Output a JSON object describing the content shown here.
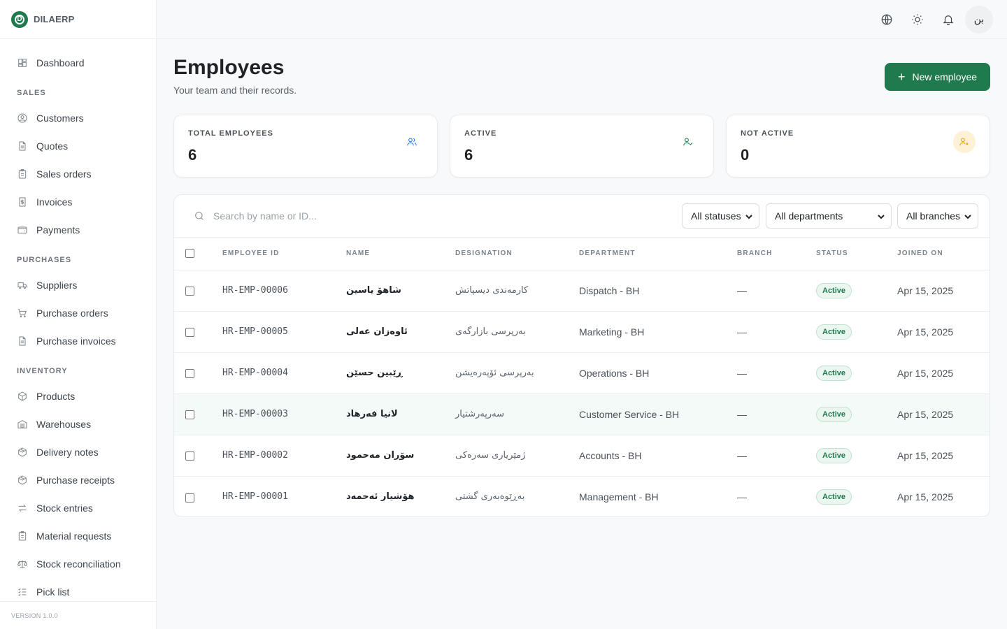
{
  "brand": {
    "logo_letter": "D",
    "name": "DILAERP"
  },
  "sidebar": {
    "top_items": [
      {
        "label": "Dashboard",
        "icon": "dashboard-icon"
      }
    ],
    "sections": [
      {
        "title": "SALES",
        "items": [
          {
            "label": "Customers",
            "icon": "user-circle-icon"
          },
          {
            "label": "Quotes",
            "icon": "document-icon"
          },
          {
            "label": "Sales orders",
            "icon": "clipboard-icon"
          },
          {
            "label": "Invoices",
            "icon": "invoice-icon"
          },
          {
            "label": "Payments",
            "icon": "wallet-icon"
          }
        ]
      },
      {
        "title": "PURCHASES",
        "items": [
          {
            "label": "Suppliers",
            "icon": "truck-icon"
          },
          {
            "label": "Purchase orders",
            "icon": "cart-icon"
          },
          {
            "label": "Purchase invoices",
            "icon": "document-icon"
          }
        ]
      },
      {
        "title": "INVENTORY",
        "items": [
          {
            "label": "Products",
            "icon": "box-icon"
          },
          {
            "label": "Warehouses",
            "icon": "warehouse-icon"
          },
          {
            "label": "Delivery notes",
            "icon": "package-icon"
          },
          {
            "label": "Purchase receipts",
            "icon": "package-icon"
          },
          {
            "label": "Stock entries",
            "icon": "arrows-icon"
          },
          {
            "label": "Material requests",
            "icon": "clipboard-icon"
          },
          {
            "label": "Stock reconciliation",
            "icon": "scale-icon"
          },
          {
            "label": "Pick list",
            "icon": "checklist-icon"
          }
        ]
      }
    ],
    "version": "VERSION 1.0.0"
  },
  "topbar": {
    "avatar_text": "بن"
  },
  "page": {
    "title": "Employees",
    "subtitle": "Your team and their records.",
    "new_button": "New employee"
  },
  "stats": [
    {
      "label": "TOTAL EMPLOYEES",
      "value": "6",
      "icon": "users-icon",
      "color": "#2b7bd6",
      "bg": "#ffffff"
    },
    {
      "label": "ACTIVE",
      "value": "6",
      "icon": "user-check-icon",
      "color": "#1f7a4d",
      "bg": "#ffffff"
    },
    {
      "label": "NOT ACTIVE",
      "value": "0",
      "icon": "user-x-icon",
      "color": "#e0a21b",
      "bg": "#fdf1d6"
    }
  ],
  "filters": {
    "search_placeholder": "Search by name or ID...",
    "status": "All statuses",
    "department": "All departments",
    "branch": "All branches"
  },
  "table": {
    "headers": [
      "EMPLOYEE ID",
      "NAME",
      "DESIGNATION",
      "DEPARTMENT",
      "BRANCH",
      "STATUS",
      "JOINED ON"
    ],
    "rows": [
      {
        "id": "HR-EMP-00006",
        "name": "شاهۆ یاسین",
        "designation": "کارمەندی دیسپاتش",
        "department": "Dispatch - BH",
        "branch": "—",
        "status": "Active",
        "joined": "Apr 15, 2025"
      },
      {
        "id": "HR-EMP-00005",
        "name": "ئاوەزان عەلی",
        "designation": "بەرپرسی بازارگەی",
        "department": "Marketing - BH",
        "branch": "—",
        "status": "Active",
        "joined": "Apr 15, 2025"
      },
      {
        "id": "HR-EMP-00004",
        "name": "ڕێبین حسێن",
        "designation": "بەرپرسی ئۆپەرەیشن",
        "department": "Operations - BH",
        "branch": "—",
        "status": "Active",
        "joined": "Apr 15, 2025"
      },
      {
        "id": "HR-EMP-00003",
        "name": "لانیا فەرهاد",
        "designation": "سەرپەرشتیار",
        "department": "Customer Service - BH",
        "branch": "—",
        "status": "Active",
        "joined": "Apr 15, 2025"
      },
      {
        "id": "HR-EMP-00002",
        "name": "سۆران مەحمود",
        "designation": "ژمێرياری سەرەکی",
        "department": "Accounts - BH",
        "branch": "—",
        "status": "Active",
        "joined": "Apr 15, 2025"
      },
      {
        "id": "HR-EMP-00001",
        "name": "هۆشیار ئەحمەد",
        "designation": "بەڕێوەبەری گشتی",
        "department": "Management - BH",
        "branch": "—",
        "status": "Active",
        "joined": "Apr 15, 2025"
      }
    ]
  }
}
